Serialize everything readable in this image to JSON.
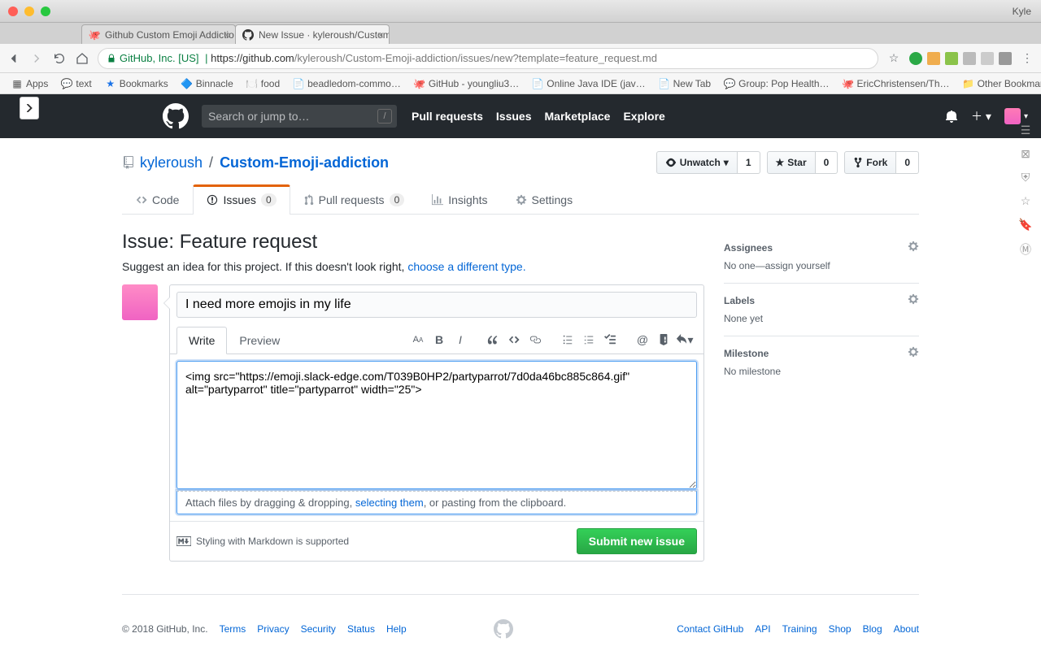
{
  "osx": {
    "user": "Kyle"
  },
  "tabs": [
    {
      "title": "Github Custom Emoji Addictio",
      "active": false
    },
    {
      "title": "New Issue · kyleroush/Custom",
      "active": true
    }
  ],
  "url": {
    "secure_label": "GitHub, Inc. [US]",
    "host": "https://github.com",
    "path": "/kyleroush/Custom-Emoji-addiction/issues/new?template=feature_request.md"
  },
  "bookmarks": {
    "apps": "Apps",
    "items": [
      "text",
      "Bookmarks",
      "Binnacle",
      "food",
      "beadledom-commo…",
      "GitHub - youngliu3…",
      "Online Java IDE (jav…",
      "New Tab",
      "Group: Pop Health…",
      "EricChristensen/Th…"
    ],
    "other": "Other Bookmarks"
  },
  "gh_header": {
    "search_placeholder": "Search or jump to…",
    "nav": [
      "Pull requests",
      "Issues",
      "Marketplace",
      "Explore"
    ]
  },
  "repo": {
    "owner": "kyleroush",
    "name": "Custom-Emoji-addiction",
    "actions": {
      "unwatch_label": "Unwatch",
      "unwatch_count": "1",
      "star_label": "Star",
      "star_count": "0",
      "fork_label": "Fork",
      "fork_count": "0"
    },
    "tabs": {
      "code": "Code",
      "issues": "Issues",
      "issues_count": "0",
      "pulls": "Pull requests",
      "pulls_count": "0",
      "insights": "Insights",
      "settings": "Settings"
    }
  },
  "issue": {
    "heading": "Issue: Feature request",
    "subtitle_prefix": "Suggest an idea for this project. If this doesn't look right, ",
    "subtitle_link": "choose a different type.",
    "title_value": "I need more emojis in my life",
    "write_tab": "Write",
    "preview_tab": "Preview",
    "body_value": "<img src=\"https://emoji.slack-edge.com/T039B0HP2/partyparrot/7d0da46bc885c864.gif\" alt=\"partyparrot\" title=\"partyparrot\" width=\"25\">",
    "attach_prefix": "Attach files by dragging & dropping, ",
    "attach_link": "selecting them",
    "attach_suffix": ", or pasting from the clipboard.",
    "md_hint": "Styling with Markdown is supported",
    "submit": "Submit new issue"
  },
  "sidebar": {
    "assignees_title": "Assignees",
    "assignees_body_prefix": "No one—",
    "assignees_body_link": "assign yourself",
    "labels_title": "Labels",
    "labels_body": "None yet",
    "milestone_title": "Milestone",
    "milestone_body": "No milestone"
  },
  "footer": {
    "copyright": "© 2018 GitHub, Inc.",
    "left": [
      "Terms",
      "Privacy",
      "Security",
      "Status",
      "Help"
    ],
    "right": [
      "Contact GitHub",
      "API",
      "Training",
      "Shop",
      "Blog",
      "About"
    ]
  }
}
